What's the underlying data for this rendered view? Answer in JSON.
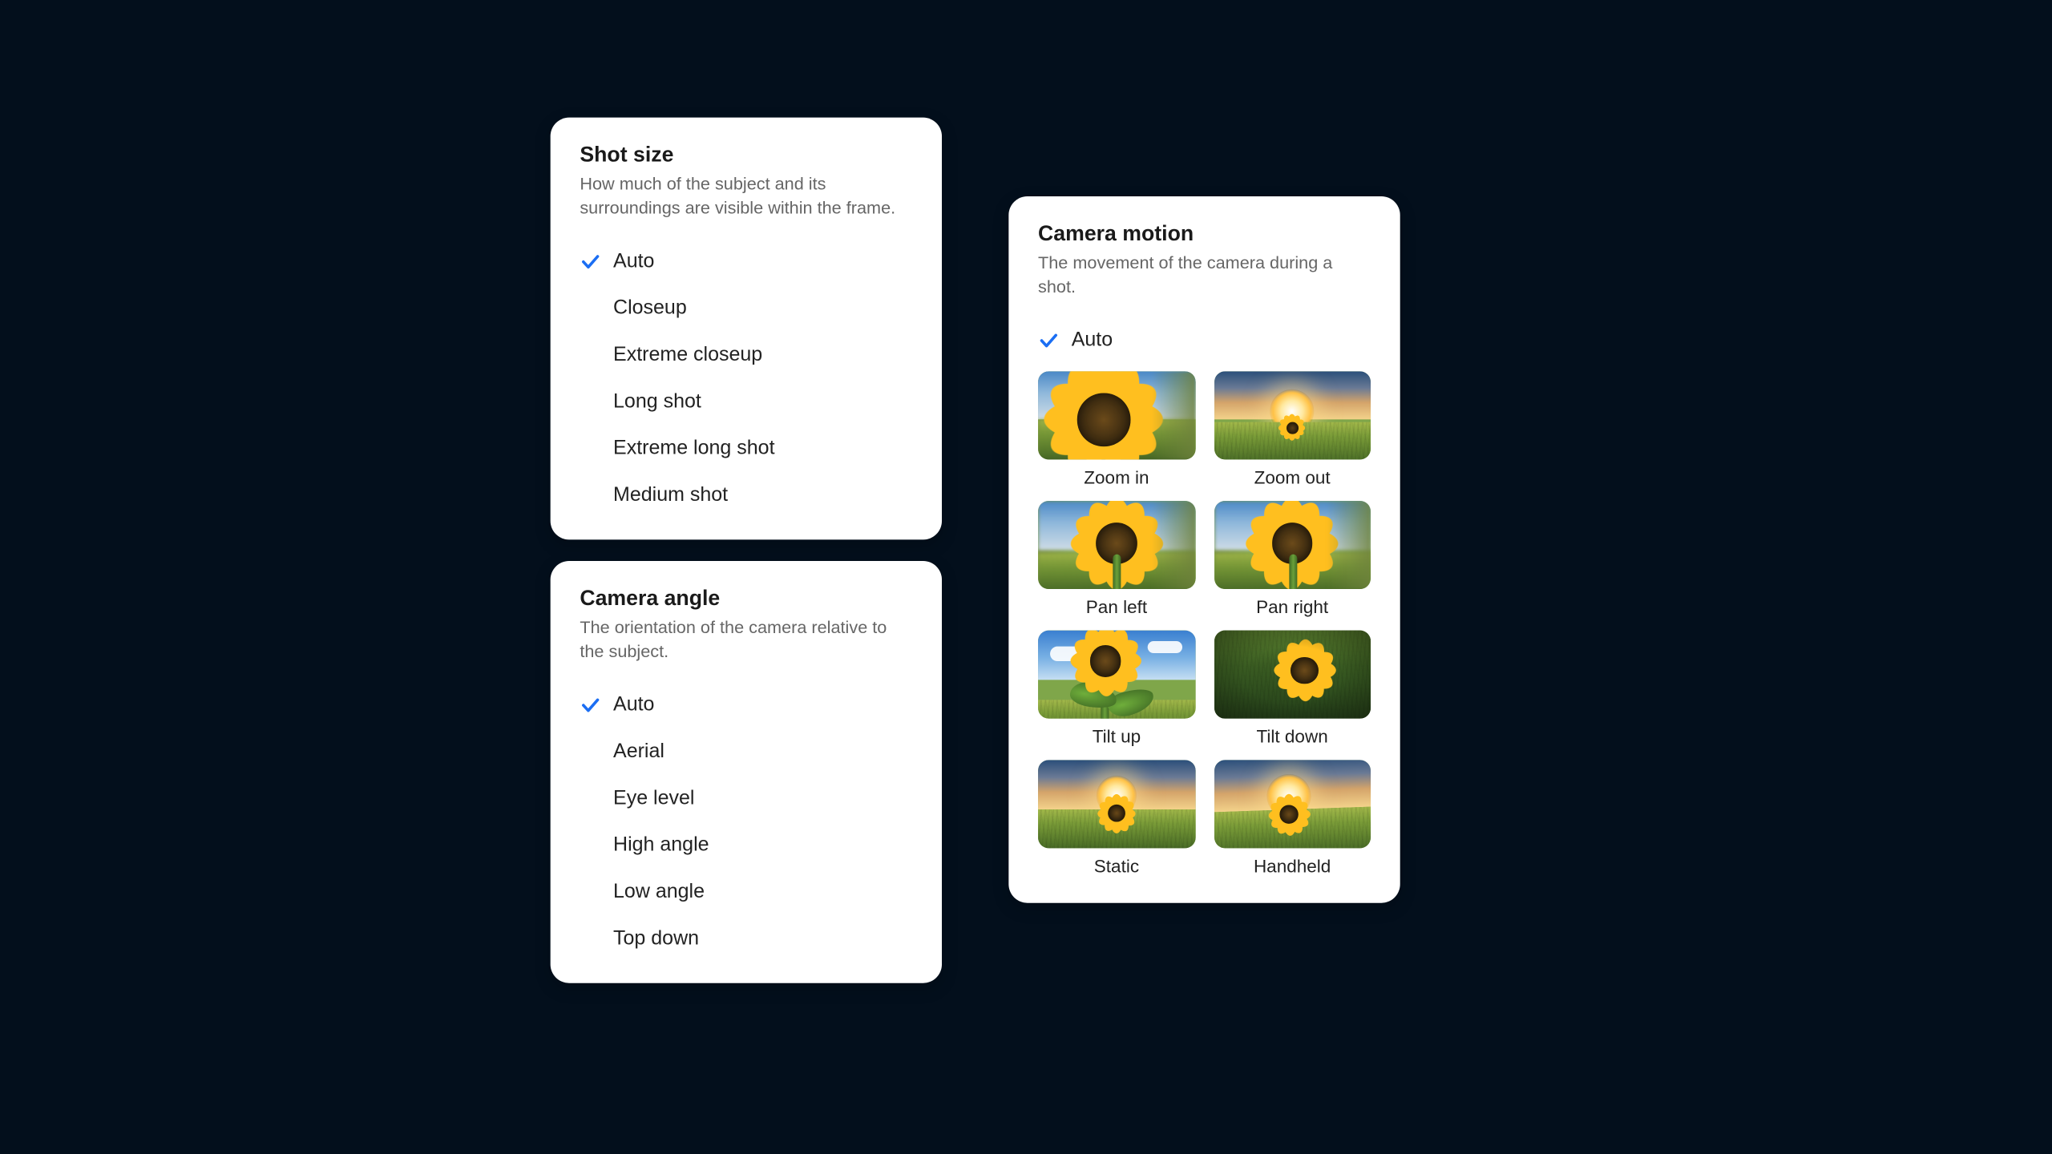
{
  "shot_size": {
    "title": "Shot size",
    "desc": "How much of the subject and its surroundings are visible within the frame.",
    "auto": "Auto",
    "options": [
      "Closeup",
      "Extreme closeup",
      "Long shot",
      "Extreme long shot",
      "Medium shot"
    ]
  },
  "camera_angle": {
    "title": "Camera angle",
    "desc": "The orientation of the camera relative to the subject.",
    "auto": "Auto",
    "options": [
      "Aerial",
      "Eye level",
      "High angle",
      "Low angle",
      "Top down"
    ]
  },
  "camera_motion": {
    "title": "Camera motion",
    "desc": "The movement of the camera during a shot.",
    "auto": "Auto",
    "items": [
      "Zoom in",
      "Zoom out",
      "Pan left",
      "Pan right",
      "Tilt up",
      "Tilt down",
      "Static",
      "Handheld"
    ]
  }
}
